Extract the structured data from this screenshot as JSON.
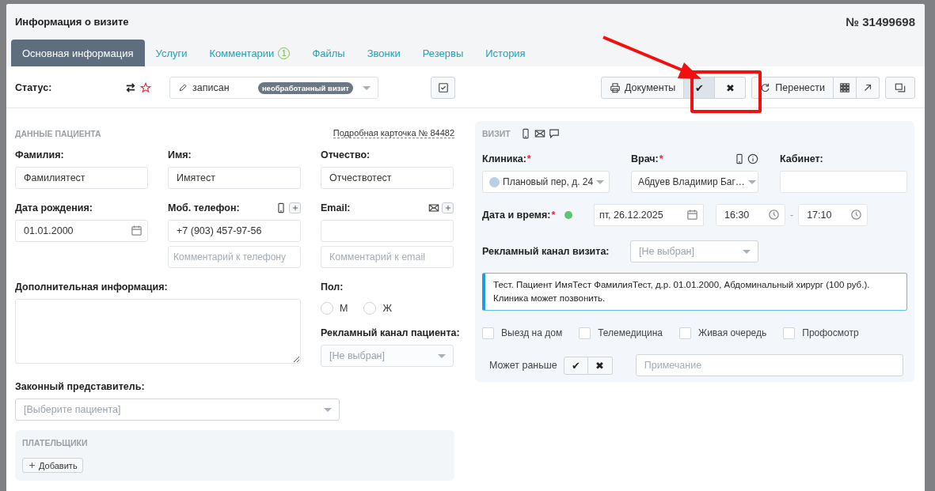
{
  "window": {
    "title": "Информация о визите",
    "number": "№ 31499698"
  },
  "tabs": [
    {
      "label": "Основная информация",
      "selected": true
    },
    {
      "label": "Услуги",
      "selected": false
    },
    {
      "label": "Комментарии",
      "badge": "1",
      "selected": false
    },
    {
      "label": "Файлы",
      "selected": false
    },
    {
      "label": "Звонки",
      "selected": false
    },
    {
      "label": "Резервы",
      "selected": false
    },
    {
      "label": "История",
      "selected": false
    }
  ],
  "toolbar": {
    "status_label": "Статус:",
    "status": {
      "value": "записан",
      "badge": "необработанный визит"
    },
    "button_groups": [
      [
        {
          "kind": "documents",
          "label": "Документы"
        },
        {
          "kind": "confirm",
          "label": "✔",
          "selected": true
        },
        {
          "kind": "cancel",
          "label": "✖",
          "selected": false
        }
      ],
      [
        {
          "kind": "reschedule",
          "label": "Перенести"
        },
        {
          "kind": "grid"
        },
        {
          "kind": "open"
        }
      ],
      [
        {
          "kind": "window"
        }
      ]
    ]
  },
  "patient": {
    "heading": "ДАННЫЕ ПАЦИЕНТА",
    "card_link": "Подробная карточка № 84482",
    "last_name": {
      "label": "Фамилия:",
      "value": "Фамилиятест"
    },
    "first_name": {
      "label": "Имя:",
      "value": "Имятест"
    },
    "middle_name": {
      "label": "Отчество:",
      "value": "Отчествотест"
    },
    "birth_date": {
      "label": "Дата рождения:",
      "value": "01.01.2000"
    },
    "phone": {
      "label": "Моб. телефон:",
      "value": "+7 (903) 457-97-56",
      "comment_placeholder": "Комментарий к телефону"
    },
    "email": {
      "label": "Email:",
      "comment_placeholder": "Комментарий к email"
    },
    "extra_info": {
      "label": "Дополнительная информация:"
    },
    "sex": {
      "label": "Пол:",
      "options": [
        {
          "label": "М",
          "selected": false
        },
        {
          "label": "Ж",
          "selected": false
        }
      ]
    },
    "ad_channel": {
      "label": "Рекламный канал пациента:",
      "placeholder": "[Не выбран]"
    },
    "representative": {
      "label": "Законный представитель:",
      "placeholder": "[Выберите пациента]"
    },
    "payers": {
      "heading": "ПЛАТЕЛЬЩИКИ",
      "add_button": "Добавить"
    }
  },
  "visit": {
    "heading": "ВИЗИТ",
    "clinic": {
      "label": "Клиника:",
      "required_mark": "*",
      "value": "Плановый пер, д. 24",
      "color": "#b9cde5"
    },
    "doctor": {
      "label": "Врач:",
      "required_mark": "*",
      "value": "Абдуев Владимир Баг…"
    },
    "room": {
      "label": "Кабинет:"
    },
    "datetime": {
      "label": "Дата и время:",
      "required_mark": "*",
      "date": "пт, 26.12.2025",
      "start": "16:30",
      "separator": "-",
      "end": "17:10"
    },
    "ad_channel": {
      "label": "Рекламный канал визита:",
      "placeholder": "[Не выбран]"
    },
    "note": "Тест. Пациент ИмяТест ФамилияТест, д.р. 01.01.2000, Абдоминальный хирург (100 руб.). Клиника может позвонить.",
    "options": [
      {
        "label": "Выезд на дом",
        "checked": false
      },
      {
        "label": "Телемедицина",
        "checked": false
      },
      {
        "label": "Живая очередь",
        "checked": false
      },
      {
        "label": "Профосмотр",
        "checked": false
      }
    ],
    "can_earlier": {
      "label": "Может раньше",
      "buttons": [
        {
          "label": "✔",
          "selected": false
        },
        {
          "label": "✖",
          "selected": false
        }
      ]
    },
    "remark": {
      "placeholder": "Примечание"
    }
  },
  "callout": {
    "visible": true
  }
}
